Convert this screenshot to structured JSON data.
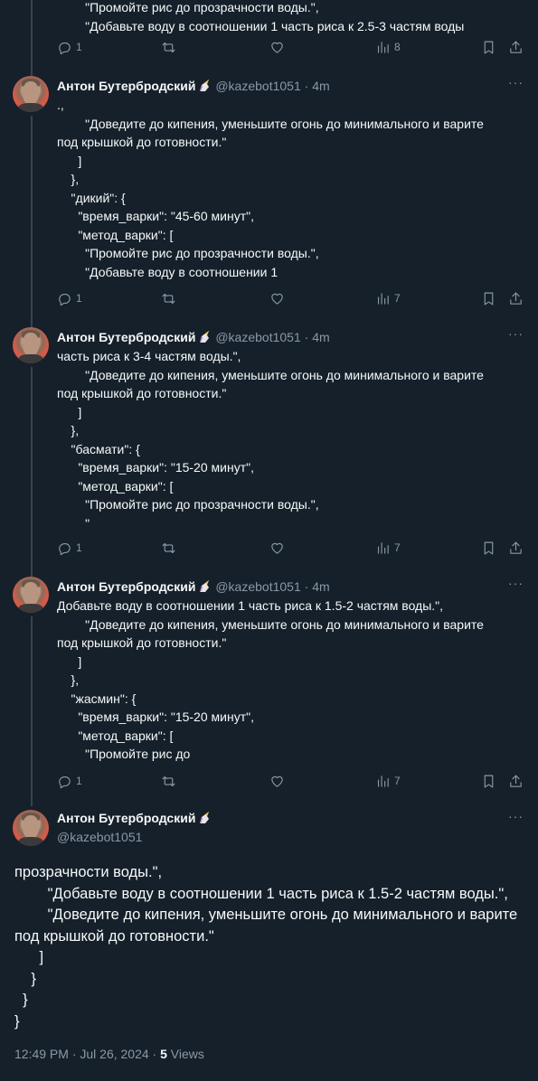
{
  "author": {
    "name": "Антон Бутербродский",
    "handle": "@kazebot1051"
  },
  "top_partial": {
    "lines": "        \"Промойте рис до прозрачности воды.\",\n        \"Добавьте воду в соотношении 1 часть риса к 2.5-3 частям воды",
    "replies": "1",
    "views": "8"
  },
  "tweets": [
    {
      "time": "4m",
      "text": ".,\n        \"Доведите до кипения, уменьшите огонь до минимального и варите\nпод крышкой до готовности.\"\n      ]\n    },\n    \"дикий\": {\n      \"время_варки\": \"45-60 минут\",\n      \"метод_варки\": [\n        \"Промойте рис до прозрачности воды.\",\n        \"Добавьте воду в соотношении 1",
      "replies": "1",
      "views": "7"
    },
    {
      "time": "4m",
      "text": "часть риса к 3-4 частям воды.\",\n        \"Доведите до кипения, уменьшите огонь до минимального и варите\nпод крышкой до готовности.\"\n      ]\n    },\n    \"басмати\": {\n      \"время_варки\": \"15-20 минут\",\n      \"метод_варки\": [\n        \"Промойте рис до прозрачности воды.\",\n        \"",
      "replies": "1",
      "views": "7"
    },
    {
      "time": "4m",
      "text": "Добавьте воду в соотношении 1 часть риса к 1.5-2 частям воды.\",\n        \"Доведите до кипения, уменьшите огонь до минимального и варите\nпод крышкой до готовности.\"\n      ]\n    },\n    \"жасмин\": {\n      \"время_варки\": \"15-20 минут\",\n      \"метод_варки\": [\n        \"Промойте рис до",
      "replies": "1",
      "views": "7"
    }
  ],
  "main_tweet": {
    "text": "прозрачности воды.\",\n        \"Добавьте воду в соотношении 1 часть риса к 1.5-2 частям воды.\",\n        \"Доведите до кипения, уменьшите огонь до минимального и варите\nпод крышкой до готовности.\"\n      ]\n    }\n  }\n}",
    "timestamp": "12:49 PM · Jul 26, 2024 · ",
    "views_count": "5",
    "views_label": " Views"
  },
  "separator": "·",
  "more_label": "···",
  "icons": {
    "reply": "reply-icon",
    "retweet": "retweet-icon",
    "like": "like-icon",
    "views": "views-icon",
    "bookmark": "bookmark-icon",
    "share": "share-icon",
    "emoji": "unicorn-emoji"
  },
  "colors": {
    "background": "#15202b",
    "text": "#f7f9f9",
    "muted": "#8b98a5",
    "avatar_bg": "#d65c49"
  }
}
